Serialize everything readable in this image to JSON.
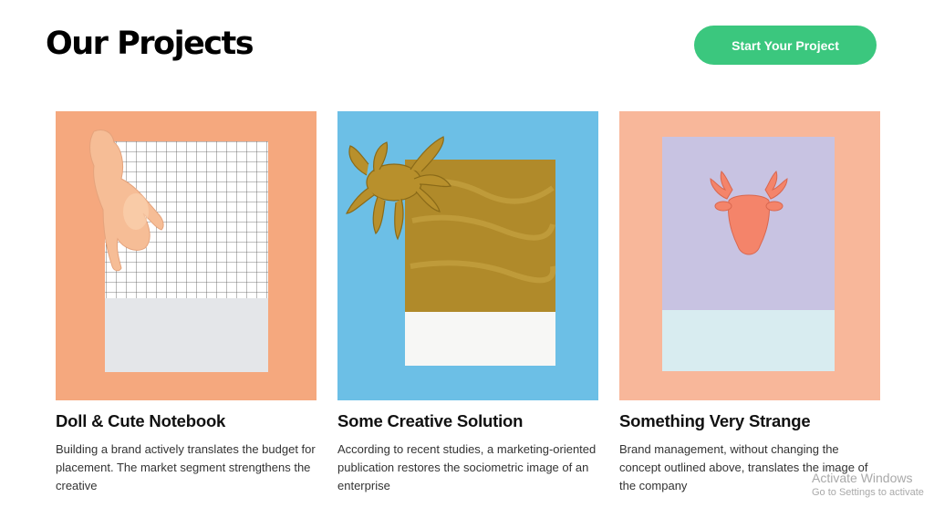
{
  "header": {
    "title": "Our Projects",
    "cta_label": "Start Your Project"
  },
  "projects": [
    {
      "title": "Doll & Cute Notebook",
      "description": "Building a brand actively translates the budget for placement. The market segment strengthens the creative",
      "image": "doll-on-grid-notebook"
    },
    {
      "title": "Some Creative Solution",
      "description": "According to recent studies, a marketing-oriented publication restores the sociometric image of an enterprise",
      "image": "gold-crab-on-gold-card"
    },
    {
      "title": "Something Very Strange",
      "description": "Brand management, without changing the concept outlined above, translates the image of the company",
      "image": "pink-moose-on-lavender-card"
    }
  ],
  "watermark": {
    "line1": "Activate Windows",
    "line2": "Go to Settings to activate"
  },
  "colors": {
    "accent": "#3bc77e",
    "peach": "#f5a87e",
    "sky_blue": "#6cbfe6",
    "salmon": "#f8b79a"
  }
}
